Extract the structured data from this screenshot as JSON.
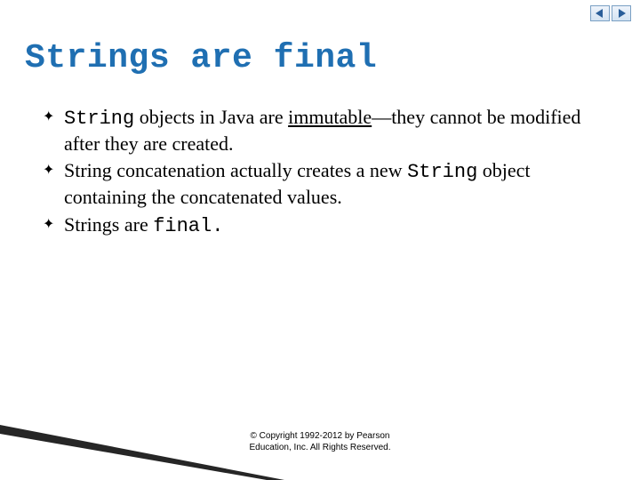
{
  "nav": {
    "prev_icon": "triangle-left-icon",
    "next_icon": "triangle-right-icon"
  },
  "title": "Strings are final",
  "bullets": [
    {
      "segments": [
        {
          "text": "String",
          "mono": true
        },
        {
          "text": " objects in Java are "
        },
        {
          "text": "immutable",
          "underline": true
        },
        {
          "text": "—they cannot be modified after they are created."
        }
      ]
    },
    {
      "segments": [
        {
          "text": "String concatenation actually creates a new "
        },
        {
          "text": "String",
          "mono": true
        },
        {
          "text": " object containing the concatenated values."
        }
      ]
    },
    {
      "segments": [
        {
          "text": "Strings are "
        },
        {
          "text": "final.",
          "mono": true
        }
      ]
    }
  ],
  "bullet_glyph": "✦",
  "copyright": {
    "line1": "© Copyright 1992-2012 by Pearson",
    "line2": "Education, Inc. All Rights Reserved."
  },
  "colors": {
    "title": "#1f6fb2",
    "nav_border": "#7aa0c4"
  }
}
